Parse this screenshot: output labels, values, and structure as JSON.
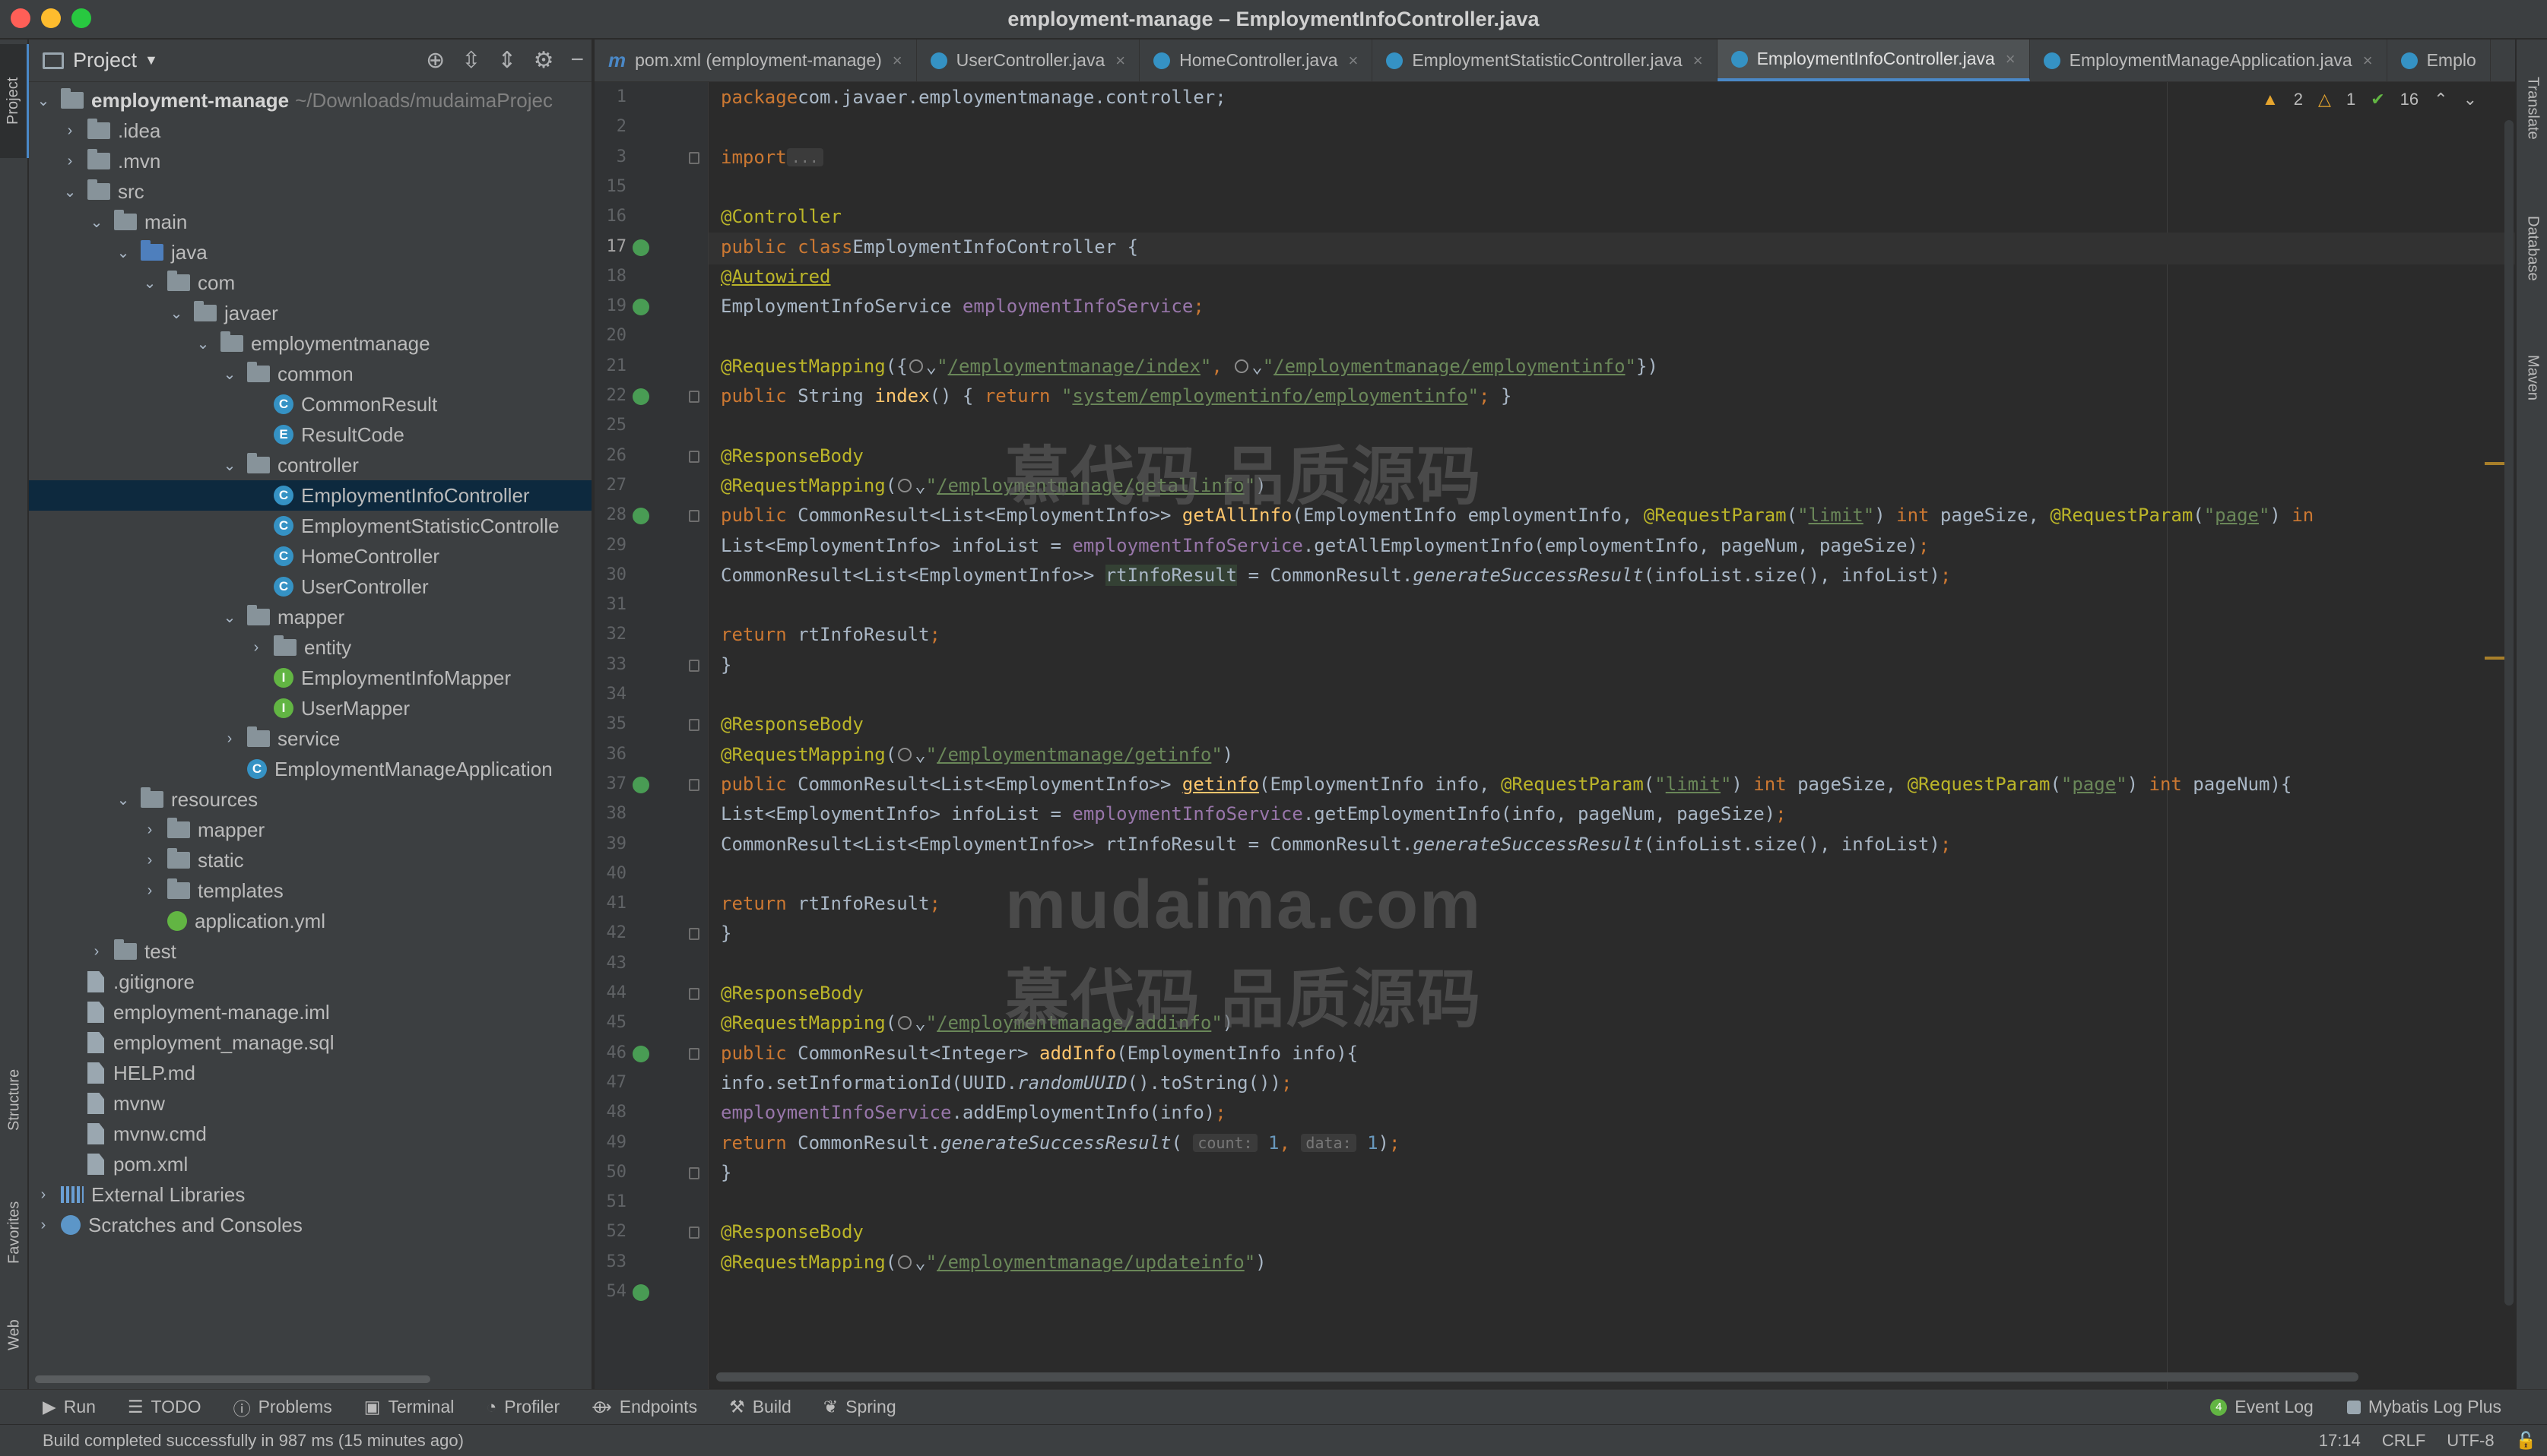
{
  "window": {
    "title": "employment-manage – EmploymentInfoController.java"
  },
  "left_strip": {
    "project": "Project",
    "structure": "Structure",
    "favorites": "Favorites",
    "web": "Web"
  },
  "right_strip": {
    "translate": "Translate",
    "database": "Database",
    "maven": "Maven"
  },
  "project_panel": {
    "title": "Project",
    "tree": [
      {
        "label": "employment-manage",
        "hint": "~/Downloads/mudaimaProjec",
        "depth": 0,
        "chev": "v",
        "icon": "folder",
        "bold": true
      },
      {
        "label": ".idea",
        "depth": 1,
        "chev": ">",
        "icon": "folder"
      },
      {
        "label": ".mvn",
        "depth": 1,
        "chev": ">",
        "icon": "folder"
      },
      {
        "label": "src",
        "depth": 1,
        "chev": "v",
        "icon": "folder"
      },
      {
        "label": "main",
        "depth": 2,
        "chev": "v",
        "icon": "folder"
      },
      {
        "label": "java",
        "depth": 3,
        "chev": "v",
        "icon": "src"
      },
      {
        "label": "com",
        "depth": 4,
        "chev": "v",
        "icon": "folder"
      },
      {
        "label": "javaer",
        "depth": 5,
        "chev": "v",
        "icon": "folder"
      },
      {
        "label": "employmentmanage",
        "depth": 6,
        "chev": "v",
        "icon": "folder"
      },
      {
        "label": "common",
        "depth": 7,
        "chev": "v",
        "icon": "folder"
      },
      {
        "label": "CommonResult",
        "depth": 8,
        "chev": "",
        "icon": "class"
      },
      {
        "label": "ResultCode",
        "depth": 8,
        "chev": "",
        "icon": "enum"
      },
      {
        "label": "controller",
        "depth": 7,
        "chev": "v",
        "icon": "folder"
      },
      {
        "label": "EmploymentInfoController",
        "depth": 8,
        "chev": "",
        "icon": "class",
        "selected": true
      },
      {
        "label": "EmploymentStatisticControlle",
        "depth": 8,
        "chev": "",
        "icon": "class"
      },
      {
        "label": "HomeController",
        "depth": 8,
        "chev": "",
        "icon": "class"
      },
      {
        "label": "UserController",
        "depth": 8,
        "chev": "",
        "icon": "class"
      },
      {
        "label": "mapper",
        "depth": 7,
        "chev": "v",
        "icon": "folder"
      },
      {
        "label": "entity",
        "depth": 8,
        "chev": ">",
        "icon": "folder"
      },
      {
        "label": "EmploymentInfoMapper",
        "depth": 8,
        "chev": "",
        "icon": "iface"
      },
      {
        "label": "UserMapper",
        "depth": 8,
        "chev": "",
        "icon": "iface"
      },
      {
        "label": "service",
        "depth": 7,
        "chev": ">",
        "icon": "folder"
      },
      {
        "label": "EmploymentManageApplication",
        "depth": 7,
        "chev": "",
        "icon": "class"
      },
      {
        "label": "resources",
        "depth": 3,
        "chev": "v",
        "icon": "folder"
      },
      {
        "label": "mapper",
        "depth": 4,
        "chev": ">",
        "icon": "folder"
      },
      {
        "label": "static",
        "depth": 4,
        "chev": ">",
        "icon": "folder"
      },
      {
        "label": "templates",
        "depth": 4,
        "chev": ">",
        "icon": "folder"
      },
      {
        "label": "application.yml",
        "depth": 4,
        "chev": "",
        "icon": "yml"
      },
      {
        "label": "test",
        "depth": 2,
        "chev": ">",
        "icon": "folder"
      },
      {
        "label": ".gitignore",
        "depth": 1,
        "chev": "",
        "icon": "file"
      },
      {
        "label": "employment-manage.iml",
        "depth": 1,
        "chev": "",
        "icon": "file"
      },
      {
        "label": "employment_manage.sql",
        "depth": 1,
        "chev": "",
        "icon": "file"
      },
      {
        "label": "HELP.md",
        "depth": 1,
        "chev": "",
        "icon": "file"
      },
      {
        "label": "mvnw",
        "depth": 1,
        "chev": "",
        "icon": "file"
      },
      {
        "label": "mvnw.cmd",
        "depth": 1,
        "chev": "",
        "icon": "file"
      },
      {
        "label": "pom.xml",
        "depth": 1,
        "chev": "",
        "icon": "file"
      },
      {
        "label": "External Libraries",
        "depth": 0,
        "chev": ">",
        "icon": "lib"
      },
      {
        "label": "Scratches and Consoles",
        "depth": 0,
        "chev": ">",
        "icon": "scratch"
      }
    ]
  },
  "tabs": [
    {
      "label": "pom.xml (employment-manage)",
      "icon": "m",
      "active": false
    },
    {
      "label": "UserController.java",
      "icon": "c",
      "active": false
    },
    {
      "label": "HomeController.java",
      "icon": "c",
      "active": false
    },
    {
      "label": "EmploymentStatisticController.java",
      "icon": "c",
      "active": false
    },
    {
      "label": "EmploymentInfoController.java",
      "icon": "c",
      "active": true
    },
    {
      "label": "EmploymentManageApplication.java",
      "icon": "c",
      "active": false
    },
    {
      "label": "Emplo",
      "icon": "c",
      "active": false
    }
  ],
  "inspections": {
    "warnings": "2",
    "weak_warnings": "1",
    "ok": "16"
  },
  "editor": {
    "current_line": "17",
    "lines": [
      {
        "n": "1",
        "html": "<span class='kw'>package</span> <span class='plain'>com.javaer.employmentmanage.controller;</span>"
      },
      {
        "n": "2",
        "html": ""
      },
      {
        "n": "3",
        "html": "<span class='kw'>import</span> <span class='hint'>...</span>",
        "fold": true
      },
      {
        "n": "15",
        "html": ""
      },
      {
        "n": "16",
        "html": "<span class='ann'>@Controller</span>"
      },
      {
        "n": "17",
        "html": "<span class='kw'>public class</span> <span class='plain'>EmploymentInfoController {</span>",
        "mark": true
      },
      {
        "n": "18",
        "html": "    <span class='ann' style='text-decoration:underline'>@Autowired</span>"
      },
      {
        "n": "19",
        "html": "    <span class='plain'>EmploymentInfoService </span><span class='fld'>employmentInfoService</span><span class='kw'>;</span>",
        "mark": true
      },
      {
        "n": "20",
        "html": ""
      },
      {
        "n": "21",
        "html": "    <span class='ann'>@RequestMapping</span><span class='plain'>({</span><span class='globe'></span><span class='plain'>⌄</span><span class='str'>\"</span><span class='url'>/employmentmanage/index</span><span class='str'>\"</span><span class='kw'>, </span><span class='globe'></span><span class='plain'>⌄</span><span class='str'>\"</span><span class='url'>/employmentmanage/employmentinfo</span><span class='str'>\"</span><span class='plain'>})</span>"
      },
      {
        "n": "22",
        "html": "    <span class='kw'>public </span><span class='plain'>String </span><span class='fn'>index</span><span class='plain'>() { </span><span class='kw'>return </span><span class='str'>\"</span><span class='url'>system/employmentinfo/employmentinfo</span><span class='str'>\"</span><span class='kw'>;</span><span class='plain'> }</span>",
        "mark": true,
        "fold": true
      },
      {
        "n": "25",
        "html": ""
      },
      {
        "n": "26",
        "html": "    <span class='ann'>@ResponseBody</span>",
        "fold": true
      },
      {
        "n": "27",
        "html": "    <span class='ann'>@RequestMapping</span><span class='plain'>(</span><span class='globe'></span><span class='plain'>⌄</span><span class='str'>\"</span><span class='url'>/employmentmanage/getallinfo</span><span class='str'>\"</span><span class='plain'>)</span>"
      },
      {
        "n": "28",
        "html": "    <span class='kw'>public </span><span class='plain'>CommonResult&lt;List&lt;EmploymentInfo&gt;&gt; </span><span class='fn'>getAllInfo</span><span class='plain'>(EmploymentInfo employmentInfo, </span><span class='ann'>@RequestParam</span><span class='plain'>(</span><span class='str'>\"</span><span class='url'>limit</span><span class='str'>\"</span><span class='plain'>) </span><span class='kw'>int </span><span class='plain'>pageSize, </span><span class='ann'>@RequestParam</span><span class='plain'>(</span><span class='str'>\"</span><span class='url'>page</span><span class='str'>\"</span><span class='plain'>) </span><span class='kw'>in</span>",
        "mark": true,
        "fold": true
      },
      {
        "n": "29",
        "html": "        <span class='plain'>List&lt;EmploymentInfo&gt; infoList = </span><span class='fld'>employmentInfoService</span><span class='plain'>.getAllEmploymentInfo(employmentInfo, pageNum, pageSize)</span><span class='kw'>;</span>"
      },
      {
        "n": "30",
        "html": "        <span class='plain'>CommonResult&lt;List&lt;EmploymentInfo&gt;&gt; </span><span class='plain hl'>rtInfoResult</span><span class='plain'> = CommonResult.</span><span class='it'>generateSuccessResult</span><span class='plain'>(infoList.size(), infoList)</span><span class='kw'>;</span>"
      },
      {
        "n": "31",
        "html": ""
      },
      {
        "n": "32",
        "html": "        <span class='kw'>return </span><span class='plain'>rtInfoResult</span><span class='kw'>;</span>"
      },
      {
        "n": "33",
        "html": "    <span class='plain'>}</span>",
        "fold": true
      },
      {
        "n": "34",
        "html": ""
      },
      {
        "n": "35",
        "html": "    <span class='ann'>@ResponseBody</span>",
        "fold": true
      },
      {
        "n": "36",
        "html": "    <span class='ann'>@RequestMapping</span><span class='plain'>(</span><span class='globe'></span><span class='plain'>⌄</span><span class='str'>\"</span><span class='url'>/employmentmanage/getinfo</span><span class='str'>\"</span><span class='plain'>)</span>"
      },
      {
        "n": "37",
        "html": "    <span class='kw'>public </span><span class='plain'>CommonResult&lt;List&lt;EmploymentInfo&gt;&gt; </span><span class='fn' style='text-decoration:underline'>getinfo</span><span class='plain'>(EmploymentInfo info, </span><span class='ann'>@RequestParam</span><span class='plain'>(</span><span class='str'>\"</span><span class='url'>limit</span><span class='str'>\"</span><span class='plain'>) </span><span class='kw'>int </span><span class='plain'>pageSize, </span><span class='ann'>@RequestParam</span><span class='plain'>(</span><span class='str'>\"</span><span class='url'>page</span><span class='str'>\"</span><span class='plain'>) </span><span class='kw'>int </span><span class='plain'>pageNum){</span>",
        "mark": true,
        "fold": true
      },
      {
        "n": "38",
        "html": "        <span class='plain'>List&lt;EmploymentInfo&gt; infoList = </span><span class='fld'>employmentInfoService</span><span class='plain'>.getEmploymentInfo(info, pageNum, pageSize)</span><span class='kw'>;</span>"
      },
      {
        "n": "39",
        "html": "        <span class='plain'>CommonResult&lt;List&lt;EmploymentInfo&gt;&gt; rtInfoResult = CommonResult.</span><span class='it'>generateSuccessResult</span><span class='plain'>(infoList.size(), infoList)</span><span class='kw'>;</span>"
      },
      {
        "n": "40",
        "html": ""
      },
      {
        "n": "41",
        "html": "        <span class='kw'>return </span><span class='plain'>rtInfoResult</span><span class='kw'>;</span>"
      },
      {
        "n": "42",
        "html": "    <span class='plain'>}</span>",
        "fold": true
      },
      {
        "n": "43",
        "html": ""
      },
      {
        "n": "44",
        "html": "    <span class='ann'>@ResponseBody</span>",
        "fold": true
      },
      {
        "n": "45",
        "html": "    <span class='ann'>@RequestMapping</span><span class='plain'>(</span><span class='globe'></span><span class='plain'>⌄</span><span class='str'>\"</span><span class='url'>/employmentmanage/addinfo</span><span class='str'>\"</span><span class='plain'>)</span>"
      },
      {
        "n": "46",
        "html": "    <span class='kw'>public </span><span class='plain'>CommonResult&lt;Integer&gt; </span><span class='fn'>addInfo</span><span class='plain'>(EmploymentInfo info){</span>",
        "mark": true,
        "fold": true
      },
      {
        "n": "47",
        "html": "        <span class='plain'>info.setInformationId(UUID.</span><span class='it'>randomUUID</span><span class='plain'>().toString())</span><span class='kw'>;</span>"
      },
      {
        "n": "48",
        "html": "        <span class='fld'>employmentInfoService</span><span class='plain'>.addEmploymentInfo(info)</span><span class='kw'>;</span>"
      },
      {
        "n": "49",
        "html": "        <span class='kw'>return </span><span class='plain'>CommonResult.</span><span class='it'>generateSuccessResult</span><span class='plain'>( </span><span class='hint'>count:</span><span class='num'> 1</span><span class='kw'>, </span><span class='hint'>data:</span><span class='num'> 1</span><span class='plain'>)</span><span class='kw'>;</span>"
      },
      {
        "n": "50",
        "html": "    <span class='plain'>}</span>",
        "fold": true
      },
      {
        "n": "51",
        "html": ""
      },
      {
        "n": "52",
        "html": "    <span class='ann'>@ResponseBody</span>",
        "fold": true
      },
      {
        "n": "53",
        "html": "    <span class='ann'>@RequestMapping</span><span class='plain'>(</span><span class='globe'></span><span class='plain'>⌄</span><span class='str'>\"</span><span class='url'>/employmentmanage/updateinfo</span><span class='str'>\"</span><span class='plain'>)</span>"
      },
      {
        "n": "54",
        "html": "",
        "mark": true
      }
    ]
  },
  "watermarks": {
    "cn_top": "慕代码 品质源码",
    "domain": "mudaima.com",
    "cn_bottom": "慕代码 品质源码"
  },
  "bottom_toolbar": {
    "left": [
      "Run",
      "TODO",
      "Problems",
      "Terminal",
      "Profiler",
      "Endpoints",
      "Build",
      "Spring"
    ],
    "event_log": "Event Log",
    "event_count": "4",
    "mybatis": "Mybatis Log Plus"
  },
  "status_bar": {
    "message": "Build completed successfully in 987 ms (15 minutes ago)",
    "position": "17:14",
    "line_sep": "CRLF",
    "encoding": "UTF-8"
  }
}
